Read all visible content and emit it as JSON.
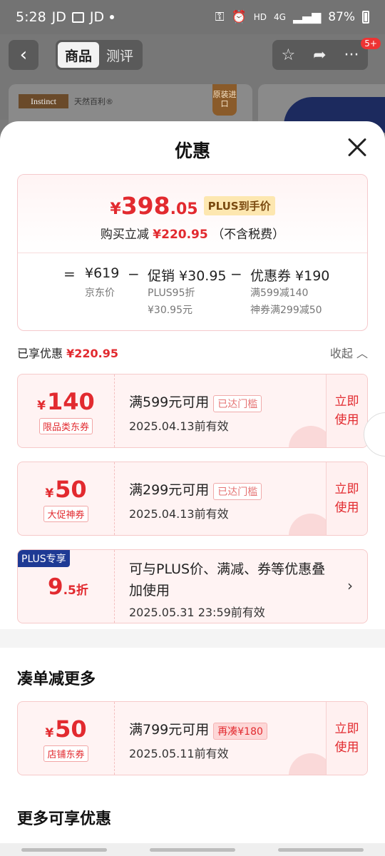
{
  "status_bar": {
    "time": "5:28",
    "app1": "JD",
    "app2": "JD",
    "hd": "HD",
    "net": "4G",
    "battery": "87%"
  },
  "nav": {
    "tab_active": "商品",
    "tab_other": "测评",
    "badge": "5+"
  },
  "background_product": {
    "brand_logo": "Instinct",
    "brand_text": "天然百利®",
    "origin_tag": "原装进口"
  },
  "sheet": {
    "title": "优惠",
    "summary": {
      "currency": "¥",
      "price_int": "398",
      "price_dec": ".05",
      "plus_tag": "PLUS到手价",
      "sub_prefix": "购买立减",
      "sub_amount": "¥220.95",
      "sub_suffix": "（不含税费）",
      "eq": "=",
      "jd_price": "¥619",
      "jd_price_label": "京东价",
      "minus1": "−",
      "promo": "促销 ¥30.95",
      "promo_line1": "PLUS95折",
      "promo_line2": "¥30.95元",
      "minus2": "−",
      "coupon": "优惠券 ¥190",
      "coupon_line1": "满599减140",
      "coupon_line2": "神券满299减50"
    },
    "enjoyed_label": "已享优惠",
    "enjoyed_amount": "¥220.95",
    "collapse": "收起",
    "coupons": [
      {
        "yen": "¥",
        "amount": "140",
        "kind": "限品类东券",
        "cond": "满599元可用",
        "threshold": "已达门槛",
        "valid": "2025.04.13前有效",
        "use": "立即使用"
      },
      {
        "yen": "¥",
        "amount": "50",
        "kind": "大促神券",
        "cond": "满299元可用",
        "threshold": "已达门槛",
        "valid": "2025.04.13前有效",
        "use": "立即使用"
      }
    ],
    "plus_card": {
      "label": "PLUS专享",
      "disc_int": "9",
      "disc_dec": ".5折",
      "desc": "可与PLUS价、满减、券等优惠叠加使用",
      "valid": "2025.05.31 23:59前有效",
      "chevron": "›"
    },
    "section1": "凑单减更多",
    "shop_coupon": {
      "yen": "¥",
      "amount": "50",
      "kind": "店铺东券",
      "cond": "满799元可用",
      "threshold": "再凑¥180",
      "valid": "2025.05.11前有效",
      "use": "立即使用"
    },
    "section2": "更多可享优惠"
  }
}
